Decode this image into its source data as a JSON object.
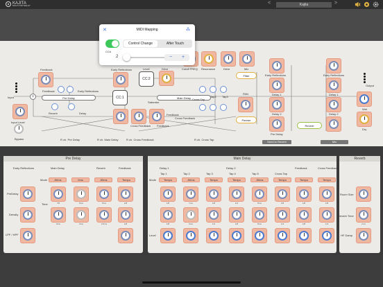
{
  "app": {
    "logo": "KAJITA",
    "logo_sub": "MULTI-TAP DELAY",
    "preset": "Kajita",
    "prev": "<",
    "next": ">"
  },
  "popup": {
    "title": "MIDI Mapping",
    "seg_left": "Control Change",
    "seg_right": "After Touch",
    "cc_label": "CC#",
    "cc_value": "2",
    "minus": "−",
    "plus": "+"
  },
  "routing": {
    "feedback_top": "Feedback",
    "feedback_left": "Feedback",
    "early_reflections": "Early Reflections",
    "early_reflections2": "Early Reflections",
    "pre_delay": "Pre Delay",
    "input": "Input",
    "input_level": "Input Level",
    "reverb": "Reverb",
    "delay": "Delay",
    "cc1": "CC:1",
    "cc2": "CC:2",
    "level": "Level",
    "drive": "Drive",
    "drive2": "Drive",
    "mix": "Mix",
    "resonance": "Resonance",
    "cutoff": "Cutoff FREQ",
    "saturator": "Saturator",
    "main_delay": "Main Delay",
    "cross_tap": "Cross Tap",
    "tap1": "Tap1",
    "tap2": "Tap2",
    "tap3": "Tap3",
    "feedback_a": "Feedback",
    "cross_feedback": "Cross Feedback",
    "cross_feedback2": "Cross Feedback",
    "feedback_b": "Feedback",
    "pan": "PAN",
    "filter": "Filter",
    "panner": "Panner",
    "r_pre": "R ch. Pre Delay",
    "r_main": "R ch. Main Delay",
    "r_cross_fb": "R ch. Cross Feedback",
    "r_cross_tap": "R ch. Cross Tap",
    "delay1": "Delay 1",
    "delay2": "Delay 2",
    "pre_delay2": "Pre Delay",
    "reverb2": "Reverb",
    "send_to_reverb": "Send to Reverb",
    "mix2": "Mix",
    "early_ref3": "Early Reflections",
    "delay1b": "Delay 1",
    "delay2b": "Delay 2",
    "output": "Output",
    "wet": "Wet",
    "dry": "Dry",
    "bypass": "Bypass"
  },
  "pre_delay_panel": {
    "title": "Pre Delay",
    "col_er": "Early Reflections",
    "col_md": "Main Delay",
    "col_rv": "Reverb",
    "col_fb": "Feedback",
    "mode": "Mode",
    "mode_v1": "-50ms",
    "mode_v2": "0ms",
    "mode_v3": "-50ms",
    "mode_v4": "Tempo",
    "predelay": "PreDelay",
    "time": "Time",
    "density": "Density",
    "lpf": "LPF / HPF",
    "time_vals": [
      "7/8",
      "8ms",
      "8ms",
      "1/8"
    ],
    "density_vals": [
      "8ms",
      "0ms",
      "2.5ms",
      "1/8"
    ]
  },
  "main_delay_panel": {
    "title": "Main Delay",
    "delay1": "Delay 1",
    "delay2": "Delay 2",
    "taps": [
      "Tap 1",
      "Tap 2",
      "Tap 3",
      "Tap 4",
      "Tap 5",
      "Cross Tap"
    ],
    "feedback": "Feedback",
    "cross_feedback": "Cross Feedback",
    "mode": "Mode",
    "modes": [
      "Tempo",
      "-50ms",
      "Tempo",
      "Tempo",
      "-50ms",
      "Tempo",
      "Tempo",
      "Tempo"
    ],
    "time": "Time",
    "level": "Level",
    "row1": [
      "1/8",
      "7ms",
      "1/8",
      "1/2",
      "8ms",
      "1/8",
      "1/8",
      "1/8"
    ],
    "row2": [
      "1/8",
      "0ms",
      "1/4",
      "1/8",
      "8ms",
      "1/4",
      "1/8",
      "1/4"
    ]
  },
  "reverb_panel": {
    "title": "Reverb",
    "room_size": "Room Size",
    "reverb_time": "Reverb Time",
    "hf_damp": "HF Damp",
    "rt_val": "2.1s"
  }
}
